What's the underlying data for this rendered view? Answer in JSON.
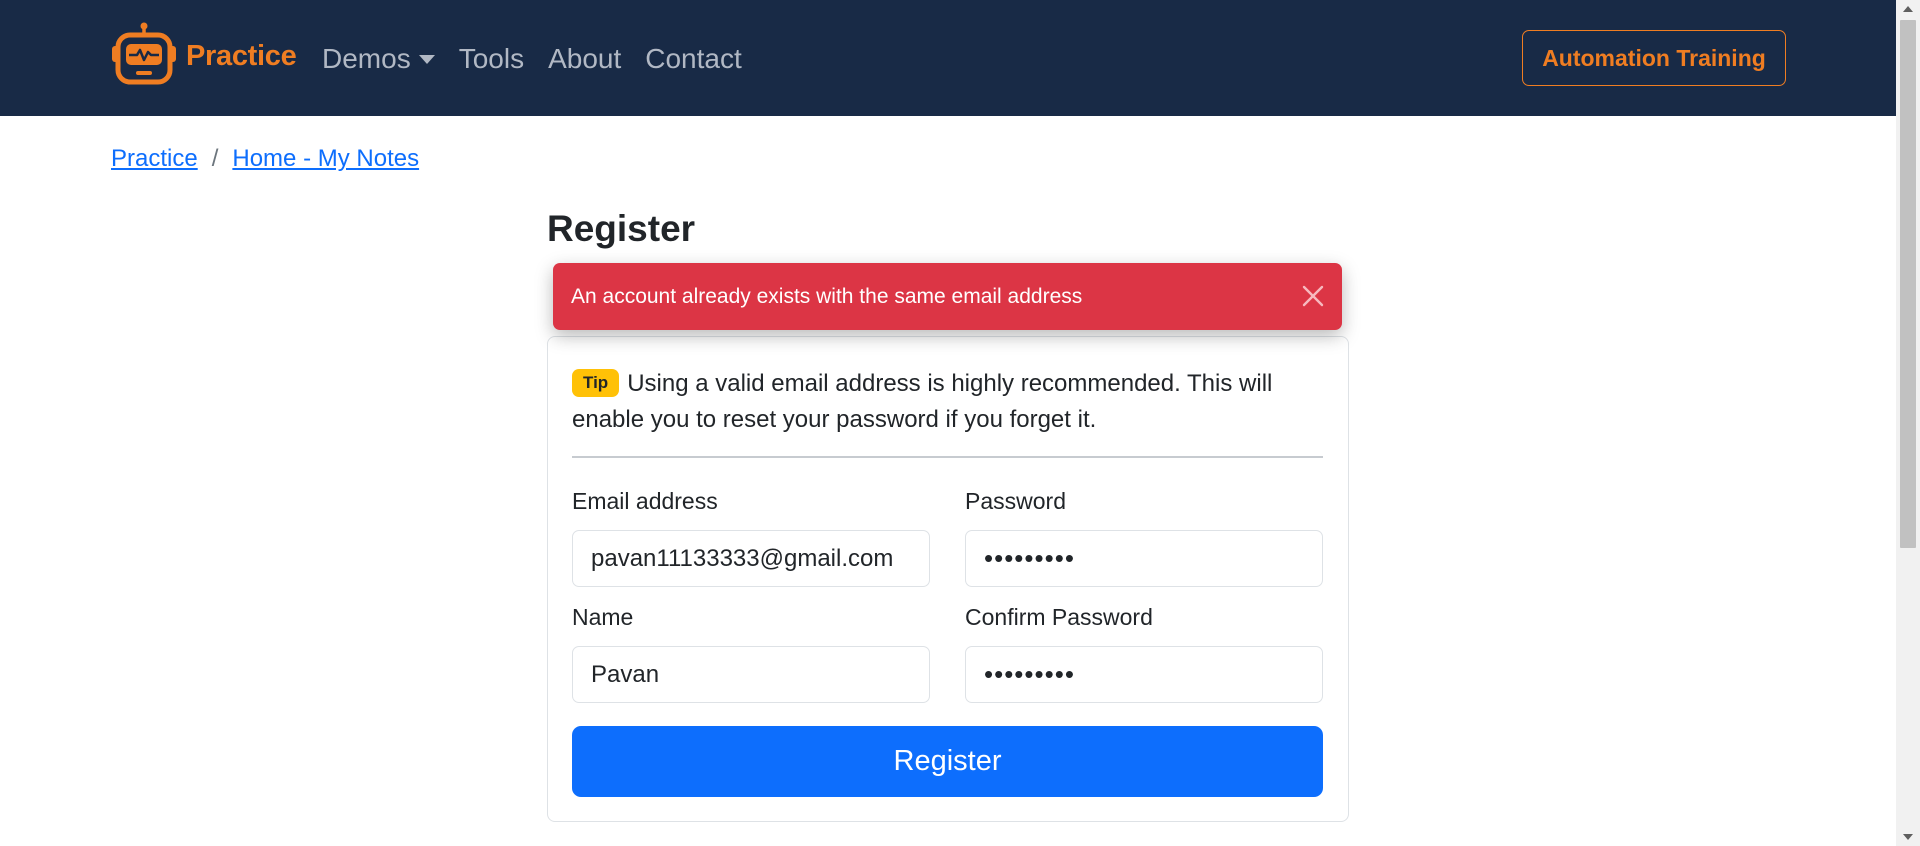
{
  "navbar": {
    "brand": "Practice",
    "links": [
      "Demos",
      "Tools",
      "About",
      "Contact"
    ],
    "cta": "Automation Training",
    "brand_color": "#ef7d22",
    "background": "#182a46"
  },
  "breadcrumb": {
    "items": [
      "Practice",
      "Home - My Notes"
    ],
    "separator": "/"
  },
  "page": {
    "title": "Register"
  },
  "alert": {
    "message": "An account already exists with the same email address",
    "color": "#dc3545"
  },
  "tip": {
    "badge": "Tip",
    "text": "Using a valid email address is highly recommended. This will enable you to reset your password if you forget it."
  },
  "form": {
    "email_label": "Email address",
    "email_value": "pavan11133333@gmail.com",
    "password_label": "Password",
    "password_value": "pavan1234",
    "name_label": "Name",
    "name_value": "Pavan",
    "confirm_label": "Confirm Password",
    "confirm_value": "pavan1234",
    "submit_label": "Register"
  }
}
